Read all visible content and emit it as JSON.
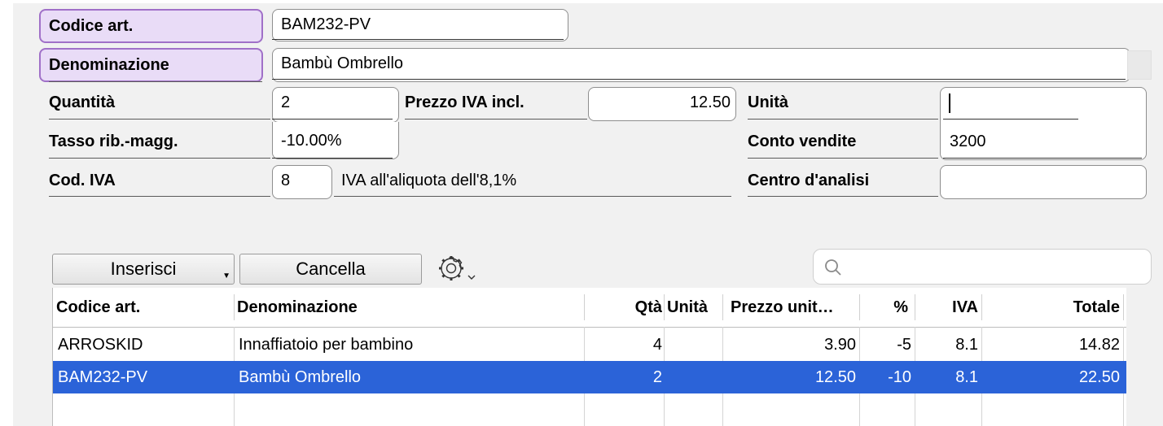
{
  "form": {
    "codice_label": "Codice art.",
    "codice_value": "BAM232-PV",
    "denominazione_label": "Denominazione",
    "denominazione_value": "Bambù Ombrello",
    "quantita_label": "Quantità",
    "quantita_value": "2",
    "prezzo_label": "Prezzo IVA incl.",
    "prezzo_value": "12.50",
    "unita_label": "Unità",
    "unita_value": "",
    "tasso_label": "Tasso rib.-magg.",
    "tasso_value": "-10.00%",
    "conto_label": "Conto vendite",
    "conto_value": "3200",
    "codiva_label": "Cod. IVA",
    "codiva_value": "8",
    "codiva_desc": "IVA all'aliquota dell'8,1%",
    "centro_label": "Centro d'analisi",
    "centro_value": ""
  },
  "toolbar": {
    "insert_label": "Inserisci",
    "delete_label": "Cancella",
    "settings_icon": "gear-icon",
    "search_icon": "search-icon",
    "search_placeholder": ""
  },
  "table": {
    "columns": [
      "Codice art.",
      "Denominazione",
      "Qtà",
      "Unità",
      "Prezzo unit…",
      "%",
      "IVA",
      "Totale"
    ],
    "rows": [
      [
        "ARROSKID",
        "Innaffiatoio per bambino",
        "4",
        "",
        "3.90",
        "-5",
        "8.1",
        "14.82"
      ],
      [
        "BAM232-PV",
        "Bambù Ombrello",
        "2",
        "",
        "12.50",
        "-10",
        "8.1",
        "22.50"
      ]
    ],
    "selected_row": 1
  },
  "colors": {
    "accent_purple": "#a070c8",
    "selection_blue": "#2b63d8"
  }
}
